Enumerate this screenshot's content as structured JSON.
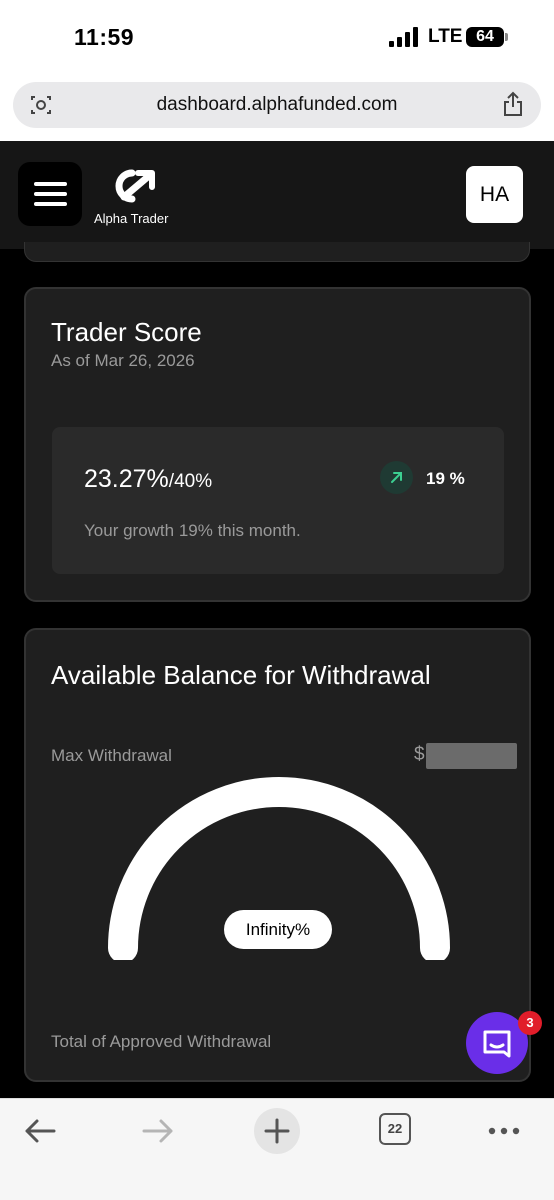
{
  "status_bar": {
    "time": "11:59",
    "network": "LTE",
    "battery": "64"
  },
  "browser": {
    "url": "dashboard.alphafunded.com",
    "tab_count": "22"
  },
  "header": {
    "brand": "Alpha Trader",
    "avatar_initials": "HA"
  },
  "trader_score": {
    "title": "Trader Score",
    "as_of": "As of Mar 26, 2026",
    "current": "23.27%",
    "target": "/40%",
    "trend_value": "19 %",
    "growth_text": "Your growth 19% this month."
  },
  "balance": {
    "title": "Available Balance for Withdrawal",
    "max_label": "Max Withdrawal",
    "currency": "$",
    "gauge_label": "Infinity%",
    "approved_label": "Total of Approved Withdrawal"
  },
  "chat": {
    "badge_count": "3"
  },
  "icons": {
    "menu": "hamburger-icon",
    "trend": "arrow-up-right-icon",
    "share": "share-icon",
    "reader": "reader-mode-icon",
    "chat": "chat-icon",
    "back": "back-arrow-icon",
    "forward": "forward-arrow-icon",
    "new_tab": "plus-icon",
    "tabs": "tabs-icon",
    "more": "more-icon"
  },
  "colors": {
    "background": "#000000",
    "card": "#1f1f1f",
    "accent_chat": "#6a2ee8",
    "trend_green": "#3ccf91",
    "badge_red": "#e11d2a"
  }
}
